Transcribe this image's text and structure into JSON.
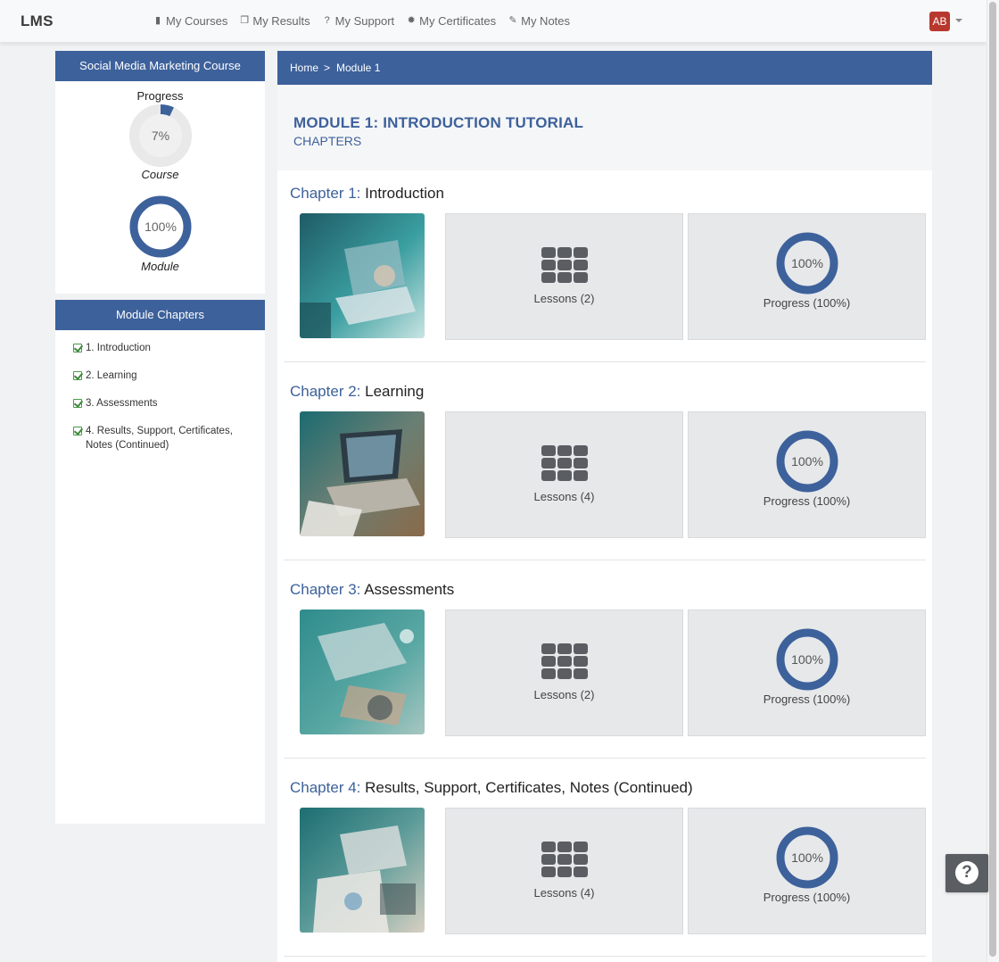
{
  "brand": "LMS",
  "nav": [
    {
      "label": "My Courses",
      "icon": "book-icon",
      "glyph": "▮"
    },
    {
      "label": "My Results",
      "icon": "copy-icon",
      "glyph": "❐"
    },
    {
      "label": "My Support",
      "icon": "question-circle-icon",
      "glyph": "?"
    },
    {
      "label": "My Certificates",
      "icon": "certificate-icon",
      "glyph": "✹"
    },
    {
      "label": "My Notes",
      "icon": "edit-icon",
      "glyph": "✎"
    }
  ],
  "user": {
    "initials": "AB"
  },
  "sidebar": {
    "course_title": "Social Media Marketing Course",
    "progress_label": "Progress",
    "course_progress": {
      "text": "7%",
      "value": 7,
      "label": "Course"
    },
    "module_progress": {
      "text": "100%",
      "value": 100,
      "label": "Module"
    },
    "chapters_title": "Module Chapters",
    "chapters": [
      "1. Introduction",
      "2. Learning",
      "3. Assessments",
      "4. Results, Support, Certificates, Notes (Continued)"
    ]
  },
  "breadcrumb": {
    "home": "Home",
    "separator": ">",
    "current": "Module 1"
  },
  "module": {
    "title": "MODULE 1: INTRODUCTION TUTORIAL",
    "subtitle": "CHAPTERS"
  },
  "chapters": [
    {
      "num_label": "Chapter 1:",
      "title": "Introduction",
      "lessons": "Lessons (2)",
      "progress_text": "100%",
      "progress_value": 100,
      "progress_label": "Progress (100%)"
    },
    {
      "num_label": "Chapter 2:",
      "title": "Learning",
      "lessons": "Lessons (4)",
      "progress_text": "100%",
      "progress_value": 100,
      "progress_label": "Progress (100%)"
    },
    {
      "num_label": "Chapter 3:",
      "title": "Assessments",
      "lessons": "Lessons (2)",
      "progress_text": "100%",
      "progress_value": 100,
      "progress_label": "Progress (100%)"
    },
    {
      "num_label": "Chapter 4:",
      "title": "Results, Support, Certificates, Notes (Continued)",
      "lessons": "Lessons (4)",
      "progress_text": "100%",
      "progress_value": 100,
      "progress_label": "Progress (100%)"
    }
  ],
  "colors": {
    "primary": "#3d619b",
    "ring_track": "#e9e9e9",
    "card_bg": "#e6e8ea",
    "avatar": "#b8382e",
    "help_button": "#5a5d62"
  }
}
